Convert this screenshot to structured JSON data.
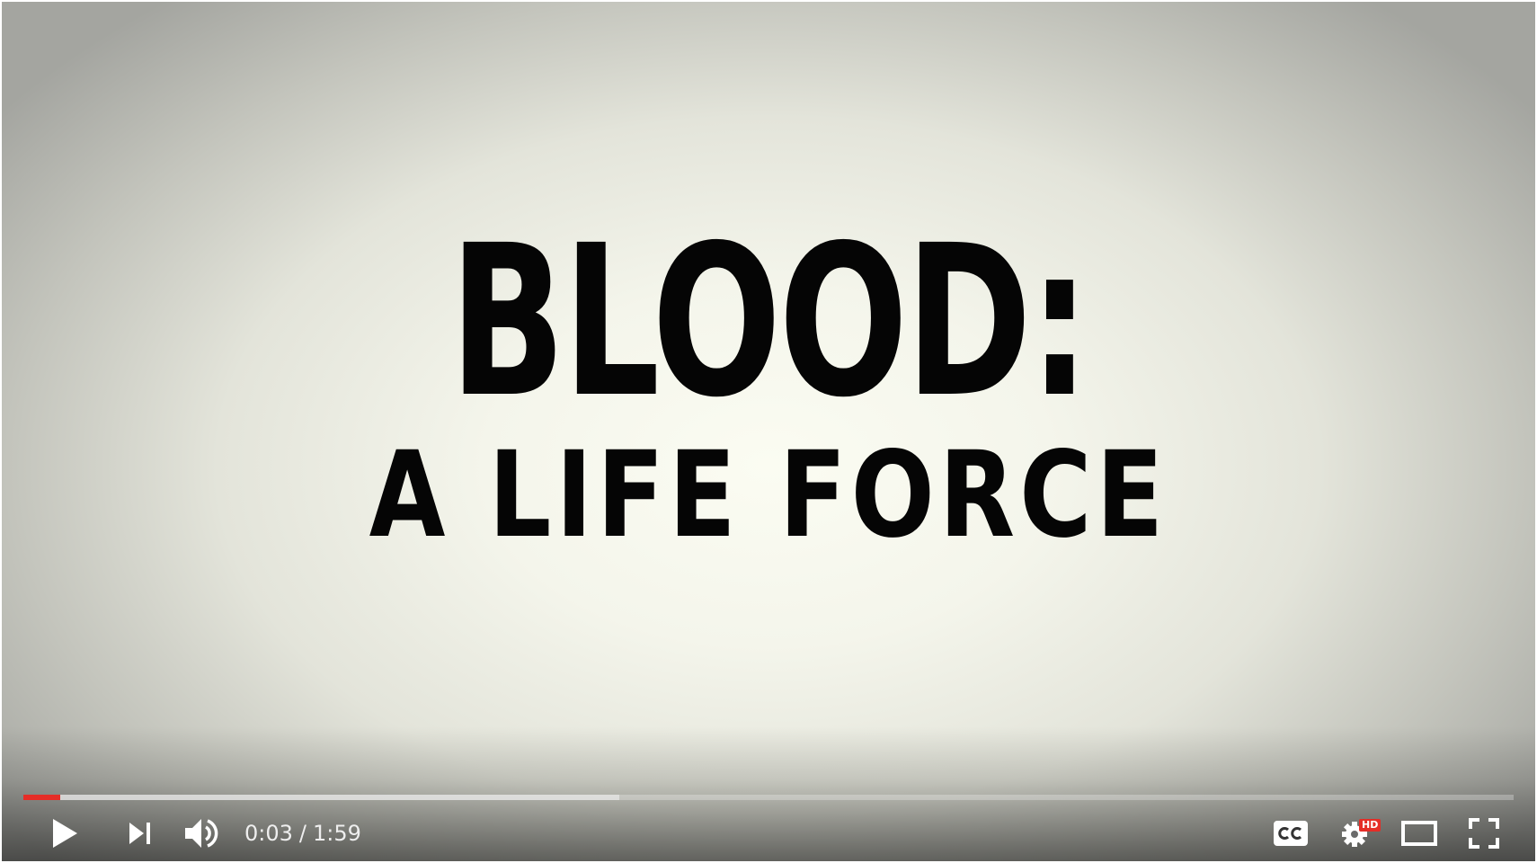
{
  "video": {
    "title_line1": "BLOOD:",
    "title_line2": "A LIFE FORCE"
  },
  "player": {
    "current_time": "0:03",
    "separator": "/",
    "duration": "1:59",
    "progress_played_fraction": 0.025,
    "progress_buffered_fraction": 0.4,
    "quality_badge": "HD",
    "colors": {
      "played": "#e52d27",
      "quality_badge": "#e52d27",
      "icons": "#ffffff"
    },
    "icons": {
      "play": "play-icon",
      "next": "next-icon",
      "volume": "volume-icon",
      "captions": "captions-icon",
      "settings": "settings-gear-icon",
      "theater": "theater-mode-icon",
      "fullscreen": "fullscreen-icon"
    }
  }
}
